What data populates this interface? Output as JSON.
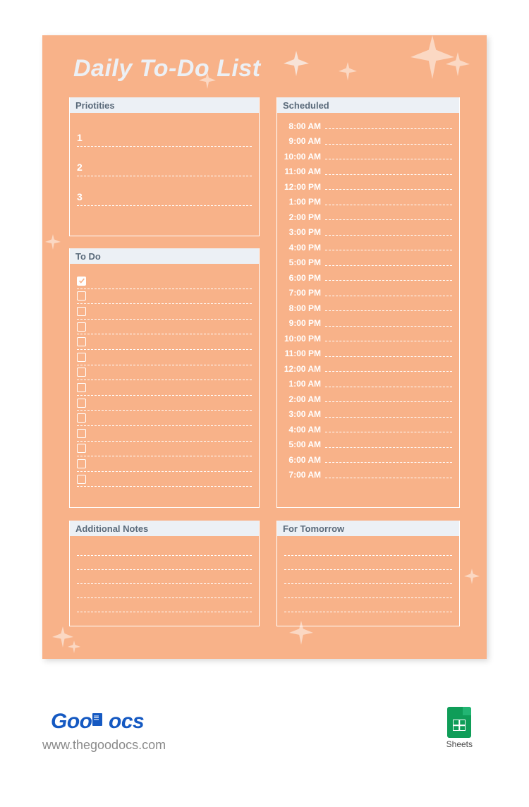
{
  "title": "Daily To-Do List",
  "sections": {
    "priorities": {
      "label": "Priotities",
      "items": [
        "1",
        "2",
        "3"
      ]
    },
    "todo": {
      "label": "To Do",
      "count": 14,
      "checked_index": 0
    },
    "scheduled": {
      "label": "Scheduled",
      "times": [
        "8:00 AM",
        "9:00 AM",
        "10:00 AM",
        "11:00 AM",
        "12:00 PM",
        "1:00 PM",
        "2:00 PM",
        "3:00 PM",
        "4:00 PM",
        "5:00 PM",
        "6:00 PM",
        "7:00 PM",
        "8:00 PM",
        "9:00 PM",
        "10:00 PM",
        "11:00 PM",
        "12:00 AM",
        "1:00 AM",
        "2:00 AM",
        "3:00 AM",
        "4:00 AM",
        "5:00 AM",
        "6:00 AM",
        "7:00 AM"
      ]
    },
    "notes": {
      "label": "Additional Notes",
      "lines": 5
    },
    "tomorrow": {
      "label": "For Tomorrow",
      "lines": 5
    }
  },
  "footer": {
    "logo_a": "Goo",
    "logo_b": "ocs",
    "url": "www.thegoodocs.com",
    "sheets": "Sheets"
  },
  "colors": {
    "page_bg": "#f8b289",
    "header_bg": "#ecf0f5",
    "header_text": "#5a6a7a"
  }
}
